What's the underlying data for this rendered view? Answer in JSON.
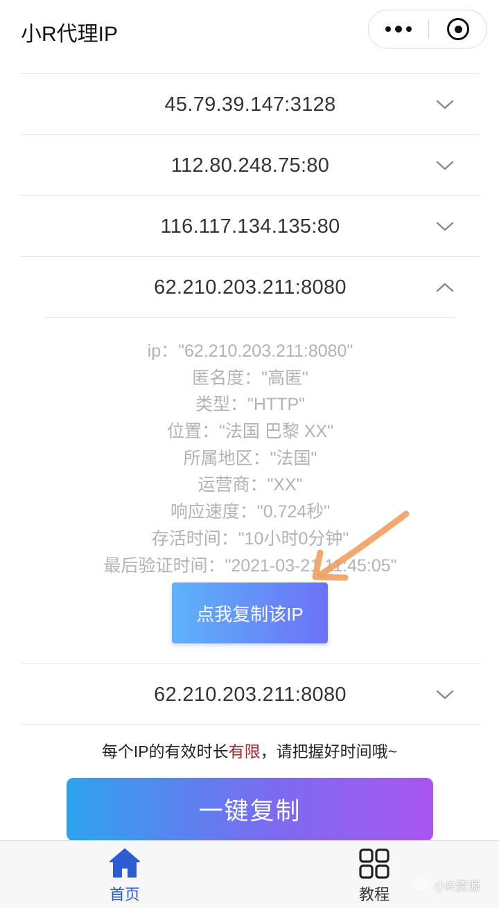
{
  "header": {
    "title": "小R代理IP",
    "more_icon": "more-dots-icon",
    "close_icon": "target-close-icon"
  },
  "proxies": [
    {
      "ip": "45.79.39.147:3128",
      "expanded": false
    },
    {
      "ip": "112.80.248.75:80",
      "expanded": false
    },
    {
      "ip": "116.117.134.135:80",
      "expanded": false
    },
    {
      "ip": "62.210.203.211:8080",
      "expanded": true
    },
    {
      "ip": "62.210.203.211:8080",
      "expanded": false
    }
  ],
  "detail": {
    "lines": [
      "ip：\"62.210.203.211:8080\"",
      "匿名度：\"高匿\"",
      "类型：\"HTTP\"",
      "位置：\"法国 巴黎 XX\"",
      "所属地区：\"法国\"",
      "运营商：\"XX\"",
      "响应速度：\"0.724秒\"",
      "存活时间：\"10小时0分钟\"",
      "最后验证时间：\"2021-03-21 11:45:05\""
    ],
    "copy_button": "点我复制该IP"
  },
  "notice": {
    "before": "每个IP的有效时长",
    "highlight": "有限",
    "after": "，请把握好时间哦~",
    "highlight_color": "#b21c2e"
  },
  "copy_all_button": "一键复制",
  "tabbar": {
    "home": {
      "label": "首页",
      "icon": "home-icon",
      "active": true
    },
    "guide": {
      "label": "教程",
      "icon": "grid-icon",
      "active": false
    }
  },
  "watermark": {
    "text": "小R资源",
    "icon": "wechat-icon"
  },
  "colors": {
    "accent": "#2d5bd4",
    "arrow": "#f0a060"
  }
}
